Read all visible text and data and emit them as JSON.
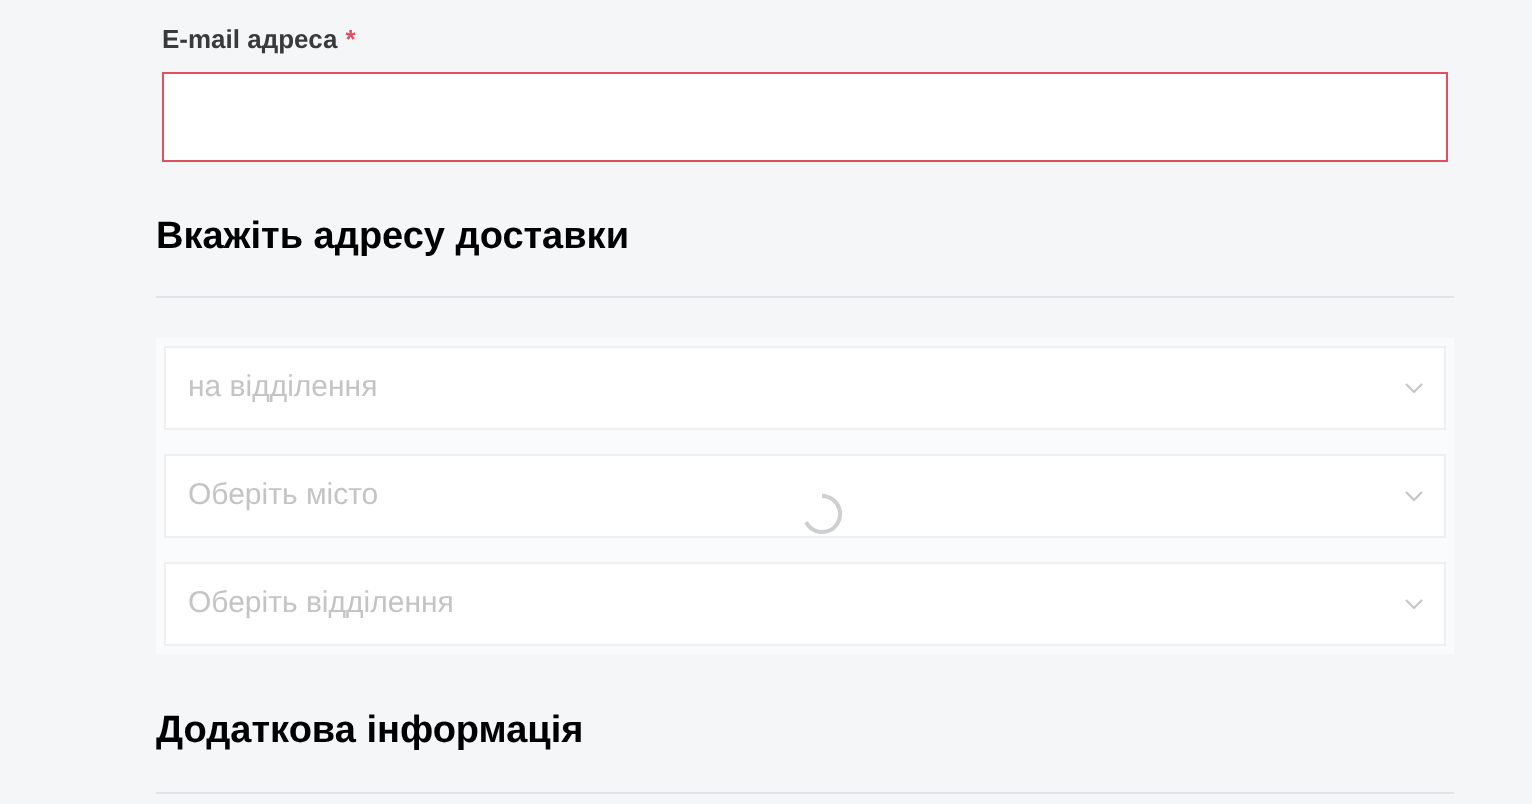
{
  "email": {
    "label": "E-mail адреса",
    "required_mark": "*",
    "invalid": true
  },
  "delivery": {
    "title": "Вкажіть адресу доставки",
    "loading": true,
    "selects": [
      {
        "placeholder": "на відділення",
        "disabled": true
      },
      {
        "placeholder": "Оберіть місто",
        "disabled": true
      },
      {
        "placeholder": "Оберіть відділення",
        "disabled": true
      }
    ]
  },
  "additional": {
    "title": "Додаткова інформація"
  }
}
